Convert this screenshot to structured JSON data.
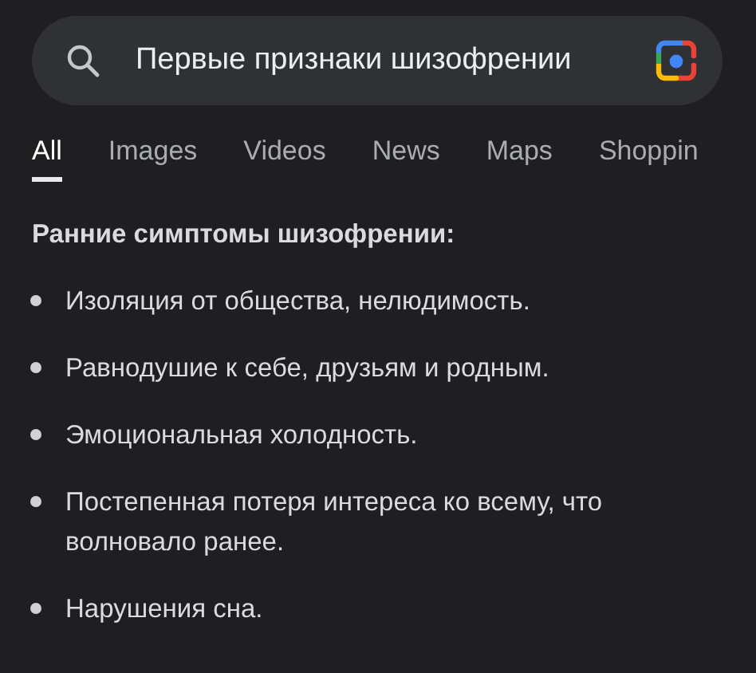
{
  "search": {
    "value": "Первые признаки шизофрении"
  },
  "tabs": [
    {
      "label": "All",
      "selected": true
    },
    {
      "label": "Images",
      "selected": false
    },
    {
      "label": "Videos",
      "selected": false
    },
    {
      "label": "News",
      "selected": false
    },
    {
      "label": "Maps",
      "selected": false
    },
    {
      "label": "Shoppin",
      "selected": false
    }
  ],
  "snippet": {
    "heading": "Ранние симптомы шизофрении:",
    "items": [
      "Изоляция от общества, нелюдимость.",
      "Равнодушие к себе, друзьям и родным.",
      "Эмоциональная холодность.",
      "Постепенная потеря интереса ко всему, что волновало ранее.",
      "Нарушения сна."
    ]
  }
}
